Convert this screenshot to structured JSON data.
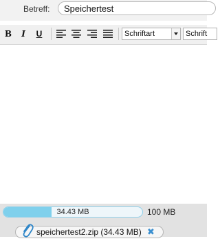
{
  "subject": {
    "label": "Betreff:",
    "value": "Speichertest"
  },
  "toolbar": {
    "bold": "B",
    "italic": "I",
    "underline": "U",
    "font_family": "Schriftart",
    "font_size": "Schrift"
  },
  "storage": {
    "used_label": "34.43 MB",
    "max_label": "100 MB",
    "used_fraction": 0.3443
  },
  "attachment": {
    "name": "speichertest2.zip (34.43 MB)",
    "remove": "✖"
  },
  "colors": {
    "progress_fill": "#7fd0ec",
    "remove_icon": "#3a8fd0"
  }
}
